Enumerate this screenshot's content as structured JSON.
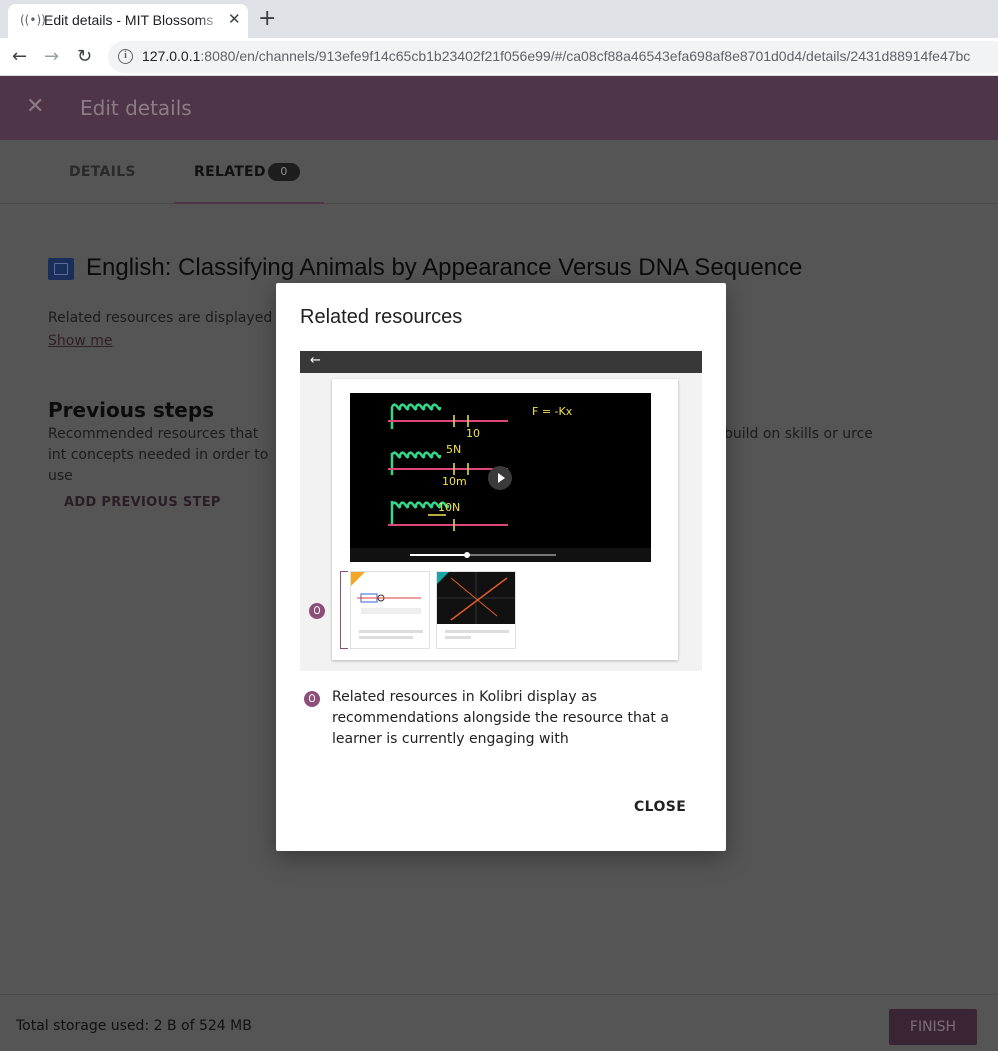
{
  "browser": {
    "tab_title": "Edit details - MIT Blossoms",
    "tab_close": "✕",
    "new_tab": "+",
    "url_host": "127.0.0.1",
    "url_rest": ":8080/en/channels/913efe9f14c65cb1b23402f21f056e99/#/ca08cf88a46543efa698af8e8701d0d4/details/2431d88914fe47bc"
  },
  "appbar": {
    "close_icon": "✕",
    "title": "Edit details"
  },
  "tabs": [
    {
      "label": "DETAILS"
    },
    {
      "label": "RELATED",
      "count": "0"
    }
  ],
  "resource": {
    "title": "English: Classifying Animals by Appearance Versus DNA Sequence",
    "description": "Related resources are displayed a",
    "show_me": "Show me"
  },
  "previous_steps": {
    "title": "Previous steps",
    "desc_left": "Recommended resources that int concepts needed in order to use",
    "desc_right": "t build on skills or urce",
    "add_label": "ADD PREVIOUS STEP"
  },
  "footer": {
    "storage": "Total storage used: 2 B of 524 MB",
    "finish_label": "FINISH"
  },
  "modal": {
    "title": "Related resources",
    "tip": "Related resources in Kolibri display as recommendations alongside the resource that a learner is currently engaging with",
    "close_label": "CLOSE"
  },
  "colors": {
    "brand": "#4f3548",
    "accent": "#8c4f7a"
  }
}
